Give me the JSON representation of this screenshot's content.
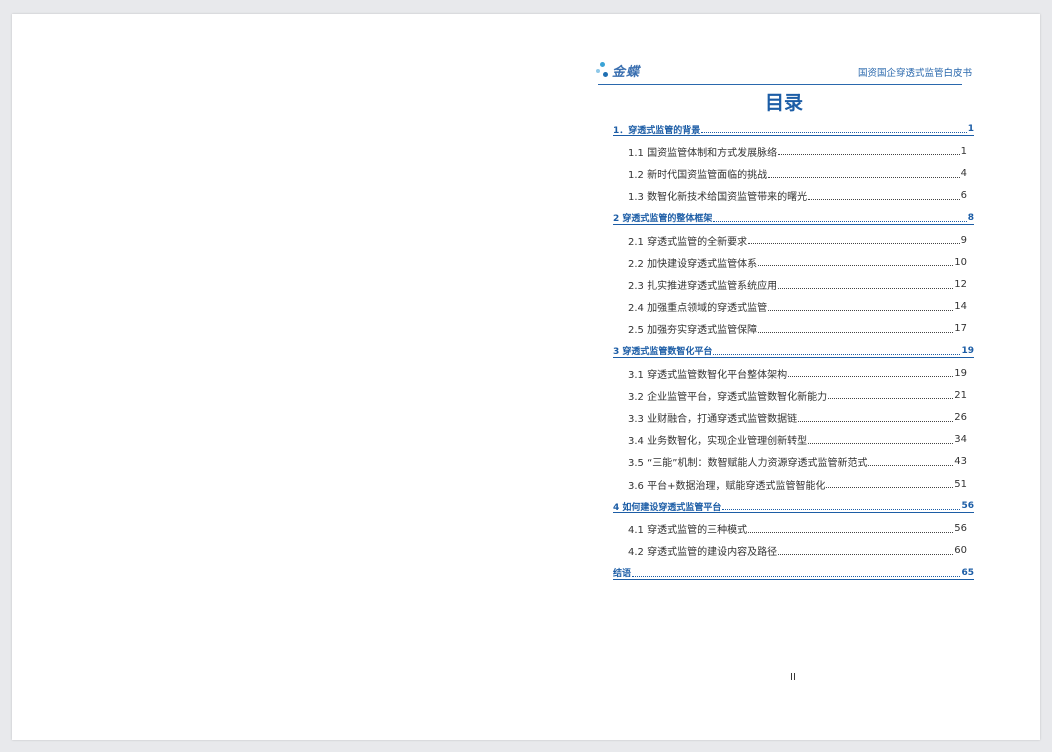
{
  "header": {
    "logo_text": "金蝶",
    "title": "国资国企穿透式监管白皮书"
  },
  "toc": {
    "heading": "目录",
    "entries": [
      {
        "level": 1,
        "label": "1．穿透式监管的背景",
        "page": "1"
      },
      {
        "level": 2,
        "label": "1.1 国资监管体制和方式发展脉络",
        "page": "1"
      },
      {
        "level": 2,
        "label": "1.2 新时代国资监管面临的挑战",
        "page": "4"
      },
      {
        "level": 2,
        "label": "1.3 数智化新技术给国资监管带来的曙光",
        "page": "6"
      },
      {
        "level": 1,
        "label": "2 穿透式监管的整体框架",
        "page": "8"
      },
      {
        "level": 2,
        "label": "2.1 穿透式监管的全新要求",
        "page": "9"
      },
      {
        "level": 2,
        "label": "2.2 加快建设穿透式监管体系",
        "page": "10"
      },
      {
        "level": 2,
        "label": "2.3 扎实推进穿透式监管系统应用",
        "page": "12"
      },
      {
        "level": 2,
        "label": "2.4 加强重点领域的穿透式监管",
        "page": "14"
      },
      {
        "level": 2,
        "label": "2.5 加强夯实穿透式监管保障",
        "page": "17"
      },
      {
        "level": 1,
        "label": "3 穿透式监管数智化平台",
        "page": "19"
      },
      {
        "level": 2,
        "label": "3.1 穿透式监管数智化平台整体架构",
        "page": "19"
      },
      {
        "level": 2,
        "label": "3.2 企业监管平台，穿透式监管数智化新能力",
        "page": "21"
      },
      {
        "level": 2,
        "label": "3.3 业财融合，打通穿透式监管数据链",
        "page": "26"
      },
      {
        "level": 2,
        "label": "3.4 业务数智化，实现企业管理创新转型",
        "page": "34"
      },
      {
        "level": 2,
        "label": "3.5 “三能”机制：数智赋能人力资源穿透式监管新范式",
        "page": "43"
      },
      {
        "level": 2,
        "label": "3.6 平台+数据治理，赋能穿透式监管智能化",
        "page": "51"
      },
      {
        "level": 1,
        "label": "4 如何建设穿透式监管平台",
        "page": "56"
      },
      {
        "level": 2,
        "label": "4.1 穿透式监管的三种模式",
        "page": "56"
      },
      {
        "level": 2,
        "label": "4.2 穿透式监管的建设内容及路径",
        "page": "60"
      },
      {
        "level": 1,
        "label": "结语",
        "page": "65"
      }
    ]
  },
  "footer": {
    "page_number": "II"
  },
  "colors": {
    "accent": "#1c5da6",
    "text": "#333333",
    "background": "#ffffff"
  }
}
